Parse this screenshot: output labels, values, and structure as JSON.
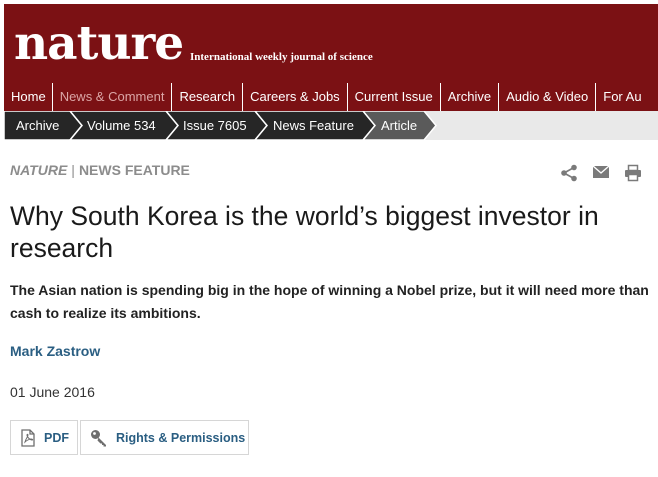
{
  "masthead": {
    "logo": "nature",
    "tagline": "International weekly journal of science",
    "background_color": "#7b1114"
  },
  "nav": {
    "items": [
      {
        "label": "Home"
      },
      {
        "label": "News & Comment",
        "active": true
      },
      {
        "label": "Research"
      },
      {
        "label": "Careers & Jobs"
      },
      {
        "label": "Current Issue"
      },
      {
        "label": "Archive"
      },
      {
        "label": "Audio & Video"
      },
      {
        "label": "For Au"
      }
    ]
  },
  "breadcrumb": {
    "items": [
      {
        "label": "Archive"
      },
      {
        "label": "Volume 534"
      },
      {
        "label": "Issue 7605"
      },
      {
        "label": "News Feature"
      },
      {
        "label": "Article",
        "current": true
      }
    ]
  },
  "article": {
    "section_journal": "NATURE",
    "section_separator": "|",
    "section_type": "NEWS FEATURE",
    "headline": "Why South Korea is the world’s biggest investor in research",
    "standfirst": "The Asian nation is spending big in the hope of winning a Nobel prize, but it will need more than cash to realize its ambitions.",
    "author": "Mark Zastrow",
    "date": "01 June 2016"
  },
  "tools": {
    "icons": [
      "share-icon",
      "mail-icon",
      "print-icon"
    ]
  },
  "actions": {
    "pdf_label": "PDF",
    "rights_label": "Rights & Permissions"
  },
  "colors": {
    "masthead": "#7b1114",
    "breadcrumb_dark": "#262626",
    "breadcrumb_current": "#5a5a5a",
    "link": "#2a5e82",
    "muted": "#8c8c8c"
  }
}
